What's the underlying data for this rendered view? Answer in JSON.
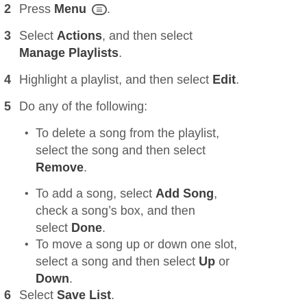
{
  "steps": [
    {
      "num": "2",
      "a": "Press ",
      "b": "Menu",
      "c": " ",
      "d": "."
    },
    {
      "num": "3",
      "a": "Select ",
      "b": "Actions",
      "c": ", and then select",
      "d": "Manage Playlists",
      "e": "."
    },
    {
      "num": "4",
      "a": "Highlight a playlist, and then select ",
      "b": "Edit",
      "c": "."
    },
    {
      "num": "5",
      "a": "Do any of the following:"
    },
    {
      "num": "6",
      "a": "Select ",
      "b": "Save List",
      "c": "."
    }
  ],
  "bullets": [
    {
      "dot": "•",
      "l1": "To delete a song from the playlist,",
      "l2": "select the song and then select",
      "l3b": "Remove",
      "l3": "."
    },
    {
      "dot": "•",
      "l1a": "To add a song, select ",
      "l1b": "Add Song",
      "l1c": ",",
      "l2": "check a song’s box, and then",
      "l3a": "select ",
      "l3b": "Done",
      "l3c": "."
    },
    {
      "dot": "•",
      "l1": "To move a song up or down one slot,",
      "l2a": "select a song and then select ",
      "l2b": "Up",
      "l2c": " or",
      "l3b": "Down",
      "l3": "."
    }
  ]
}
